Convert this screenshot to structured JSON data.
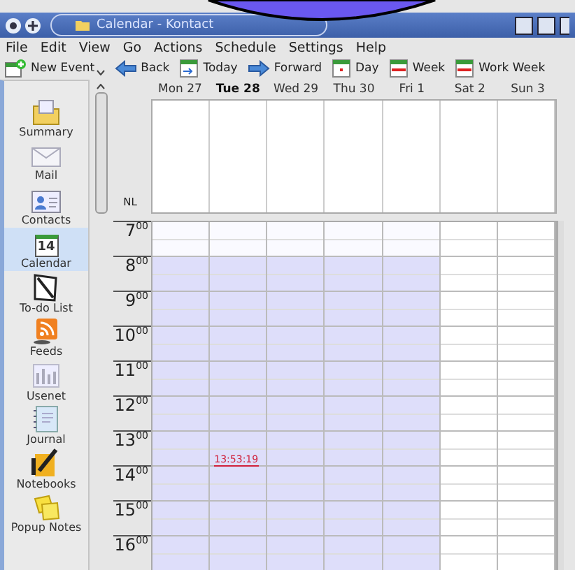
{
  "window": {
    "title": "Calendar - Kontact"
  },
  "menu": [
    "File",
    "Edit",
    "View",
    "Go",
    "Actions",
    "Schedule",
    "Settings",
    "Help"
  ],
  "toolbar": [
    {
      "label": "New Event",
      "kind": "new"
    },
    {
      "label": "Back",
      "kind": "back"
    },
    {
      "label": "Today",
      "kind": "today"
    },
    {
      "label": "Forward",
      "kind": "forward"
    },
    {
      "label": "Day",
      "kind": "day"
    },
    {
      "label": "Week",
      "kind": "week"
    },
    {
      "label": "Work Week",
      "kind": "week"
    }
  ],
  "sidebar": {
    "items": [
      {
        "label": "Summary",
        "kind": "summary",
        "selected": false
      },
      {
        "label": "Mail",
        "kind": "mail",
        "selected": false
      },
      {
        "label": "Contacts",
        "kind": "contacts",
        "selected": false
      },
      {
        "label": "Calendar",
        "kind": "calendar",
        "icon_text": "14",
        "selected": true
      },
      {
        "label": "To-do List",
        "kind": "todo",
        "selected": false
      },
      {
        "label": "Feeds",
        "kind": "feeds",
        "selected": false
      },
      {
        "label": "Usenet",
        "kind": "usenet",
        "selected": false
      },
      {
        "label": "Journal",
        "kind": "journal",
        "selected": false
      },
      {
        "label": "Notebooks",
        "kind": "notebooks",
        "selected": false
      },
      {
        "label": "Popup Notes",
        "kind": "notes",
        "selected": false
      }
    ]
  },
  "calendar": {
    "all_day_label": "NL",
    "days": [
      {
        "label": "Mon 27",
        "today": false,
        "working": true
      },
      {
        "label": "Tue 28",
        "today": true,
        "working": true,
        "current_time": "13:53:19"
      },
      {
        "label": "Wed 29",
        "today": false,
        "working": true
      },
      {
        "label": "Thu 30",
        "today": false,
        "working": true
      },
      {
        "label": "Fri 1",
        "today": false,
        "working": true
      },
      {
        "label": "Sat 2",
        "today": false,
        "working": false
      },
      {
        "label": "Sun 3",
        "today": false,
        "working": false
      }
    ],
    "hours": [
      {
        "label": "7$^{00}$",
        "working": false
      },
      {
        "label": "8$^{00}$",
        "working": true
      },
      {
        "label": "9$^{00}$",
        "working": true
      },
      {
        "label": "10$^{00}$",
        "working": true
      },
      {
        "label": "11$^{00}$",
        "working": true
      },
      {
        "label": "12$^{00}$",
        "working": true
      },
      {
        "label": "13$^{00}$",
        "working": true,
        "now": true
      },
      {
        "label": "14$^{00}$",
        "working": true
      },
      {
        "label": "15$^{00}$",
        "working": true
      },
      {
        "label": "16$^{00}$",
        "working": true
      }
    ]
  }
}
